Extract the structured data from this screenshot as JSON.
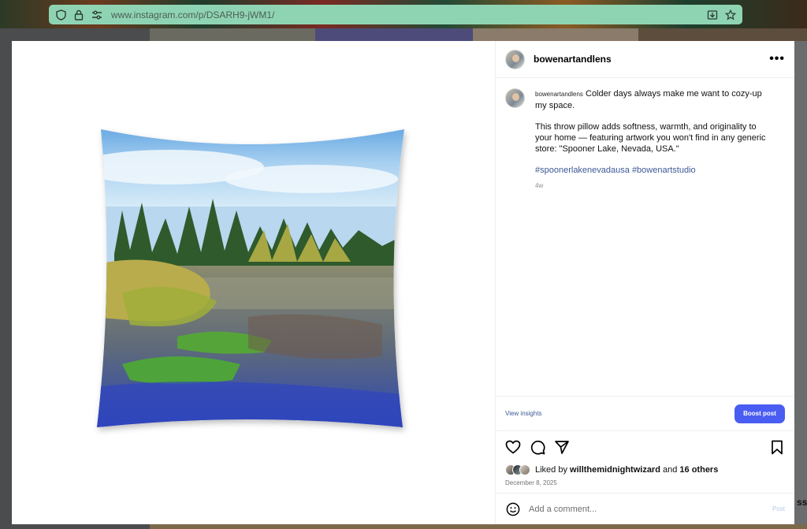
{
  "browser": {
    "url": "www.instagram.com/p/DSARH9-jWM1/"
  },
  "post": {
    "username": "bowenartandlens",
    "more_label": "•••",
    "caption": {
      "username": "bowenartandlens",
      "line1": "Colder days always make me want to cozy-up my space.",
      "line2": "This throw pillow adds softness, warmth, and originality to your home — featuring artwork you won't find in any generic store: \"Spooner Lake, Nevada, USA.\"",
      "hashtag1": "#spoonerlakenevadausa",
      "hashtag2": "#bowenartstudio",
      "time_ago": "4w"
    },
    "insights_label": "View insights",
    "boost_label": "Boost post",
    "likes": {
      "prefix": "Liked by",
      "user": "willthemidnightwizard",
      "and": "and",
      "others": "16 others"
    },
    "date": "December 8, 2025",
    "comment_placeholder": "Add a comment...",
    "post_label": "Post"
  },
  "background": {
    "edge_text": "ssa"
  },
  "icons": {
    "shield": "shield-icon",
    "lock": "lock-icon",
    "permissions": "permissions-icon",
    "download": "download-icon",
    "star": "star-icon",
    "heart": "heart-icon",
    "comment": "comment-icon",
    "share": "share-icon",
    "bookmark": "bookmark-icon",
    "emoji": "emoji-icon"
  },
  "colors": {
    "urlbar": "#8fd4b2",
    "link": "#3d5a96",
    "boost": "#4a5df2"
  }
}
